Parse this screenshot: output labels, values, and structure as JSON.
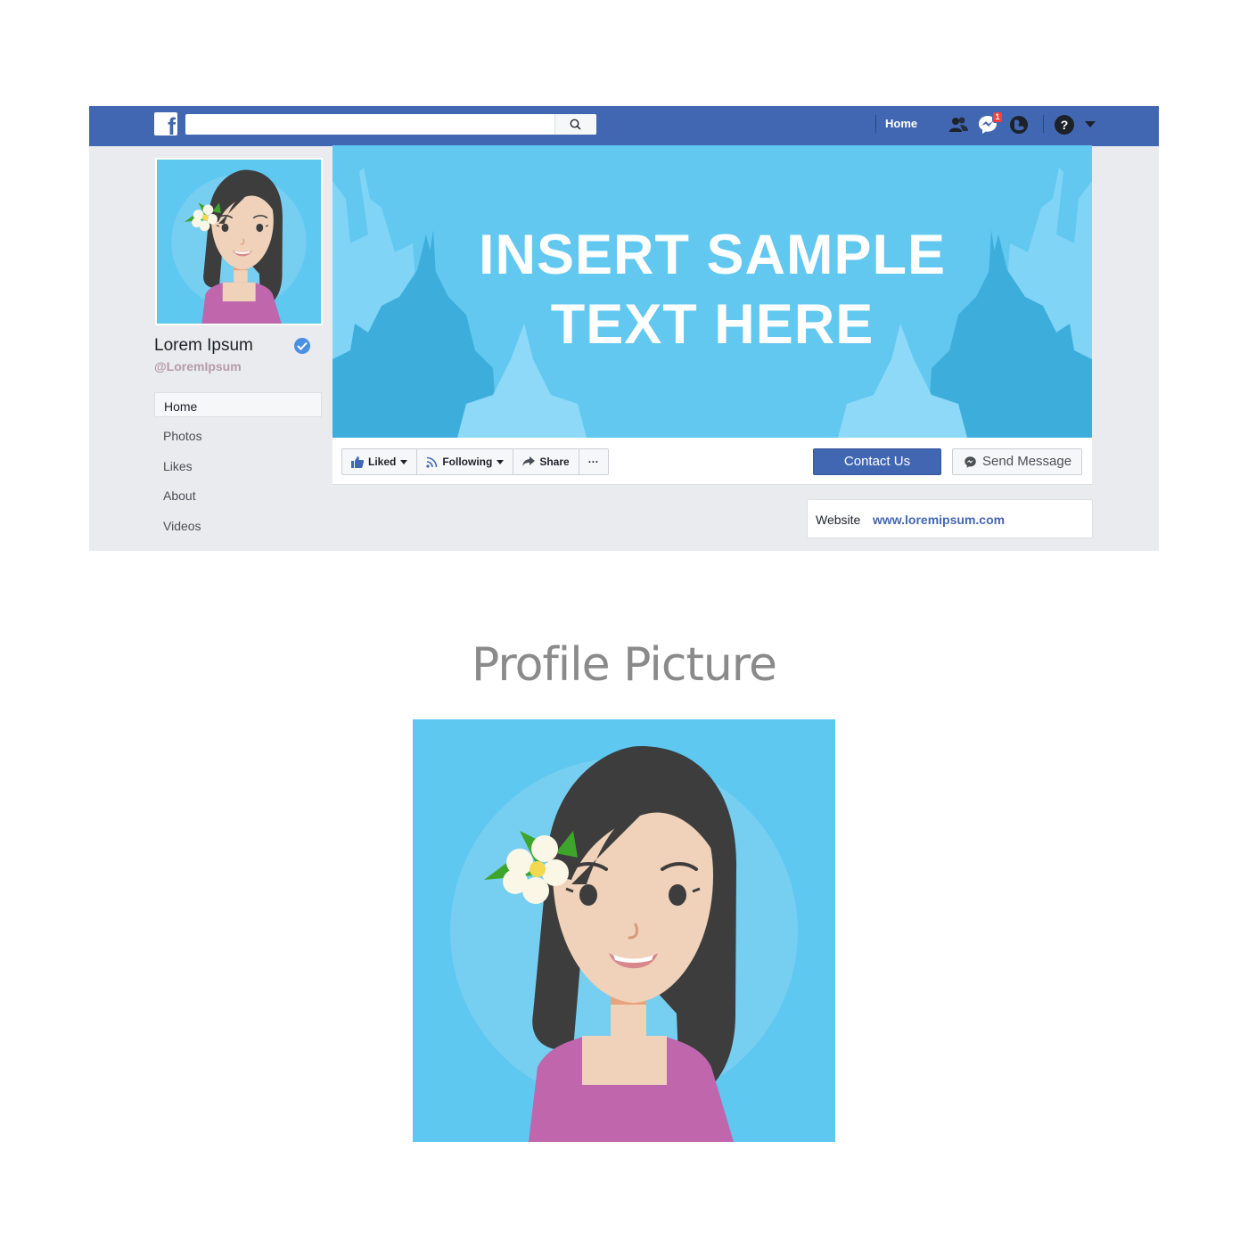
{
  "topbar": {
    "logo_letter": "f",
    "search_placeholder": "",
    "home_label": "Home",
    "notification_count": "1",
    "help_glyph": "?",
    "icons": [
      "friends-icon",
      "messenger-icon",
      "globe-icon",
      "help-icon",
      "chevron-down-icon"
    ]
  },
  "page": {
    "name": "Lorem Ipsum",
    "handle": "@LoremIpsum",
    "verified": true
  },
  "sidebar": {
    "items": [
      {
        "label": "Home",
        "active": true
      },
      {
        "label": "Photos",
        "active": false
      },
      {
        "label": "Likes",
        "active": false
      },
      {
        "label": "About",
        "active": false
      },
      {
        "label": "Videos",
        "active": false
      }
    ]
  },
  "cover": {
    "line1": "INSERT SAMPLE",
    "line2": "TEXT HERE"
  },
  "actions": {
    "liked": "Liked",
    "following": "Following",
    "share": "Share",
    "more": "···",
    "contact": "Contact Us",
    "message": "Send Message"
  },
  "website": {
    "label": "Website",
    "url": "www.loremipsum.com"
  },
  "section": {
    "title": "Profile Picture"
  },
  "colors": {
    "brand_blue": "#4267b2",
    "page_bg": "#e9ebee",
    "cover_blue": "#62c8f0",
    "badge_red": "#fa3e3e",
    "shirt_purple": "#c066ad",
    "hair": "#3d3d3d",
    "skin": "#efd2b9"
  }
}
